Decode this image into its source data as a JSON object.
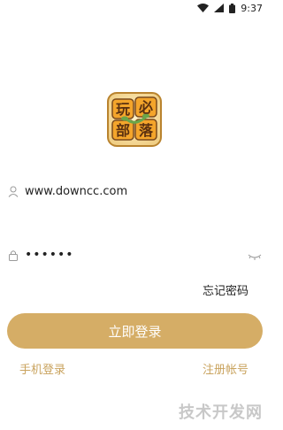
{
  "status_bar": {
    "time": "9:37",
    "icons": [
      "wifi-icon",
      "signal-icon",
      "battery-icon"
    ]
  },
  "logo": {
    "text": "玩必部落",
    "colors": {
      "orange": "#f4a52b",
      "green": "#6aa64a",
      "border": "#7a4a1d"
    }
  },
  "login_form": {
    "username": {
      "value": "www.downcc.com",
      "icon": "user-icon"
    },
    "password": {
      "value": "••••••",
      "icon": "lock-icon",
      "toggle_icon": "eye-closed-icon"
    },
    "forgot_password_label": "忘记密码",
    "login_button_label": "立即登录",
    "phone_login_label": "手机登录",
    "register_label": "注册帐号"
  },
  "watermark": {
    "text": "技术开发网"
  },
  "colors": {
    "accent": "#d5ad66",
    "link": "#c9a35e",
    "text": "#222222"
  }
}
